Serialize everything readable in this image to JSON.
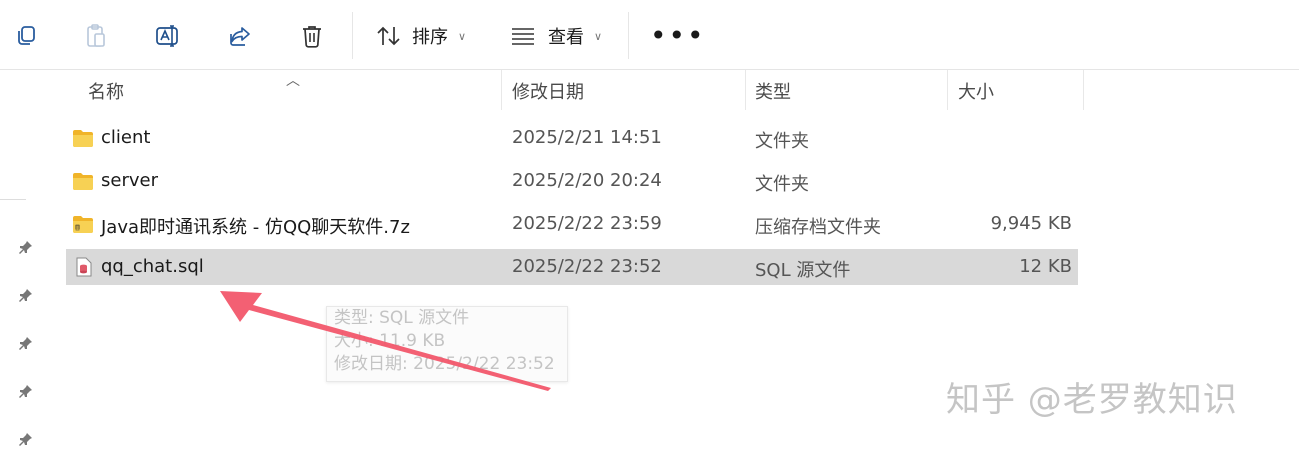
{
  "toolbar": {
    "icons": [
      "copy-icon",
      "paste-icon",
      "rename-icon",
      "share-icon",
      "delete-icon"
    ],
    "sort_label": "排序",
    "view_label": "查看",
    "more_label": "•••"
  },
  "columns": {
    "name": "名称",
    "date": "修改日期",
    "type": "类型",
    "size": "大小"
  },
  "files": [
    {
      "name": "client",
      "date": "2025/2/21 14:51",
      "type": "文件夹",
      "size": "",
      "icon": "folder-icon"
    },
    {
      "name": "server",
      "date": "2025/2/20 20:24",
      "type": "文件夹",
      "size": "",
      "icon": "folder-icon"
    },
    {
      "name": "Java即时通讯系统 - 仿QQ聊天软件.7z",
      "date": "2025/2/22 23:59",
      "type": "压缩存档文件夹",
      "size": "9,945 KB",
      "icon": "archive-icon"
    },
    {
      "name": "qq_chat.sql",
      "date": "2025/2/22 23:52",
      "type": "SQL 源文件",
      "size": "12 KB",
      "icon": "sql-file-icon",
      "selected": true
    }
  ],
  "tooltip": {
    "type_line": "类型: SQL 源文件",
    "size_line": "大小: 11.9 KB",
    "date_line": "修改日期: 2025/2/22 23:52"
  },
  "watermark": "知乎 @老罗教知识",
  "colors": {
    "arrow": "#f2576b",
    "folder": "#f7c948",
    "selection": "#d9d9d9"
  }
}
